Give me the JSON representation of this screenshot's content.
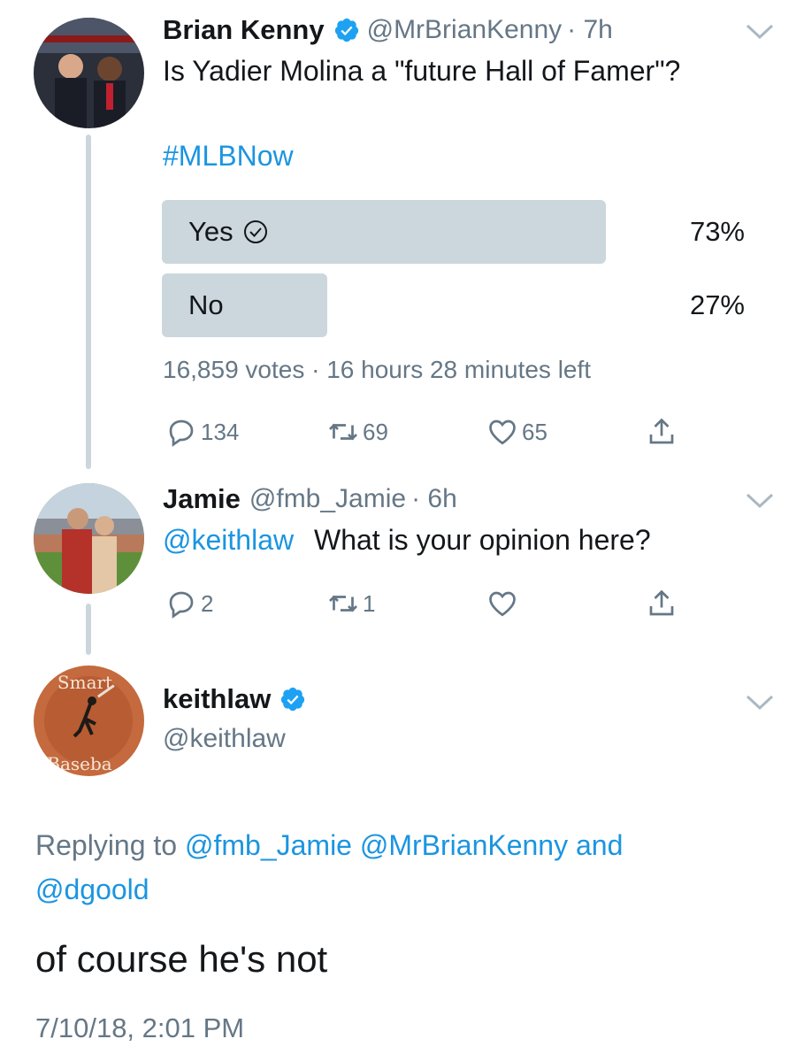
{
  "tweets": [
    {
      "name": "Brian Kenny",
      "handle": "@MrBrianKenny",
      "time": "· 7h",
      "text": "Is Yadier Molina a \"future Hall of Famer\"?",
      "hashtag": "#MLBNow",
      "verified": true,
      "poll": {
        "options": [
          {
            "label": "Yes",
            "percent": "73%",
            "value": 73,
            "chosen": true
          },
          {
            "label": "No",
            "percent": "27%",
            "value": 27,
            "chosen": false
          }
        ],
        "meta": "16,859 votes · 16 hours 28 minutes left"
      },
      "actions": {
        "reply": "134",
        "retweet": "69",
        "like": "65"
      }
    },
    {
      "name": "Jamie",
      "handle": "@fmb_Jamie",
      "time": "· 6h",
      "mention": "@keithlaw",
      "text": "What is your opinion here?",
      "actions": {
        "reply": "2",
        "retweet": "1",
        "like": ""
      }
    },
    {
      "name": "keithlaw",
      "handle": "@keithlaw",
      "verified": true,
      "avatar_text_top": "Smart",
      "avatar_text_bottom": "Baseba",
      "replying_prefix": "Replying to",
      "replying_users": "@fmb_Jamie @MrBrianKenny",
      "replying_and": "and",
      "replying_last": "@dgoold",
      "text": "of course he's not",
      "timestamp": "7/10/18, 2:01 PM"
    }
  ],
  "colors": {
    "link": "#1b95e0",
    "muted": "#657786",
    "bar": "#ccd6dd",
    "text": "#14171a"
  },
  "icons": [
    "verified-badge-icon",
    "chevron-down-icon",
    "reply-icon",
    "retweet-icon",
    "like-icon",
    "share-icon",
    "check-circle-icon"
  ]
}
